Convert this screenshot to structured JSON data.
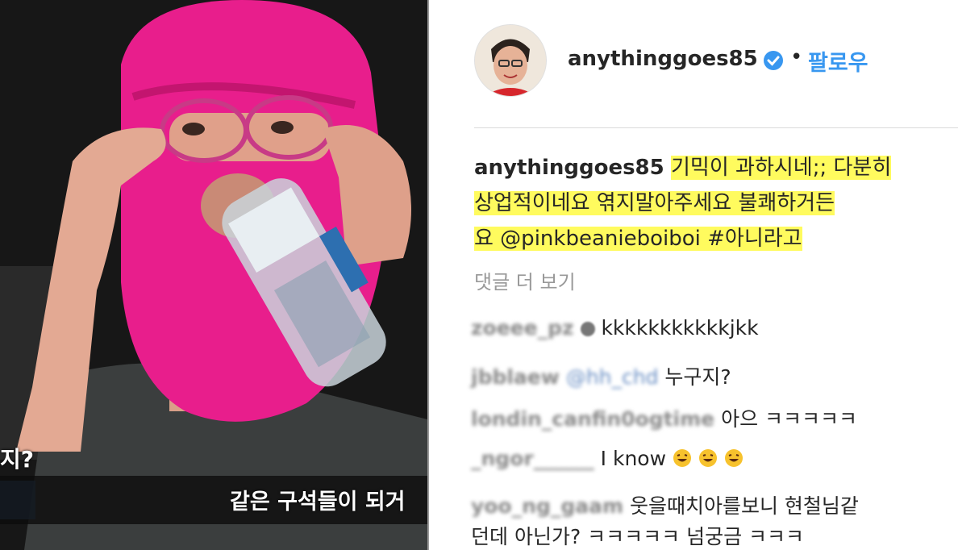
{
  "video": {
    "subtitle_left": "지?",
    "subtitle_main": "같은 구석들이 되거"
  },
  "post": {
    "username": "anythinggoes85",
    "dot": "•",
    "follow_label": "팔로우",
    "caption_user": "anythinggoes85",
    "caption_line1": "기믹이 과하시네;; 다분히",
    "caption_line2": "상업적이네요 엮지말아주세요 불쾌하거든",
    "caption_line3": "요 @pinkbeanieboiboi #아니라고",
    "more_comments": "댓글 더 보기"
  },
  "comments": [
    {
      "user": "zoeee_pz",
      "mention": "",
      "text": "kkkkkkkkkkkjkk"
    },
    {
      "user": "jbblaew",
      "mention": "@hh_chd",
      "text": "누구지?"
    },
    {
      "user": "londin_canfin0ogtime",
      "mention": "",
      "text": "아으 ㅋㅋㅋㅋㅋ"
    },
    {
      "user": "_ngor______",
      "mention": "",
      "text": "I know"
    },
    {
      "user": "yoo_ng_gaam",
      "mention": "",
      "text": "웃을때치아를보니 현철님같",
      "text2": "던데 아닌가? ㅋㅋㅋㅋㅋ 넘궁금 ㅋㅋㅋ"
    }
  ],
  "colors": {
    "highlight": "#fffb5e",
    "follow": "#3897f0",
    "mask_pink": "#e81e8c",
    "verified": "#3897f0"
  },
  "icons": {
    "verified": "verified-badge-icon",
    "emoji": "laughing-emoji-icon"
  }
}
